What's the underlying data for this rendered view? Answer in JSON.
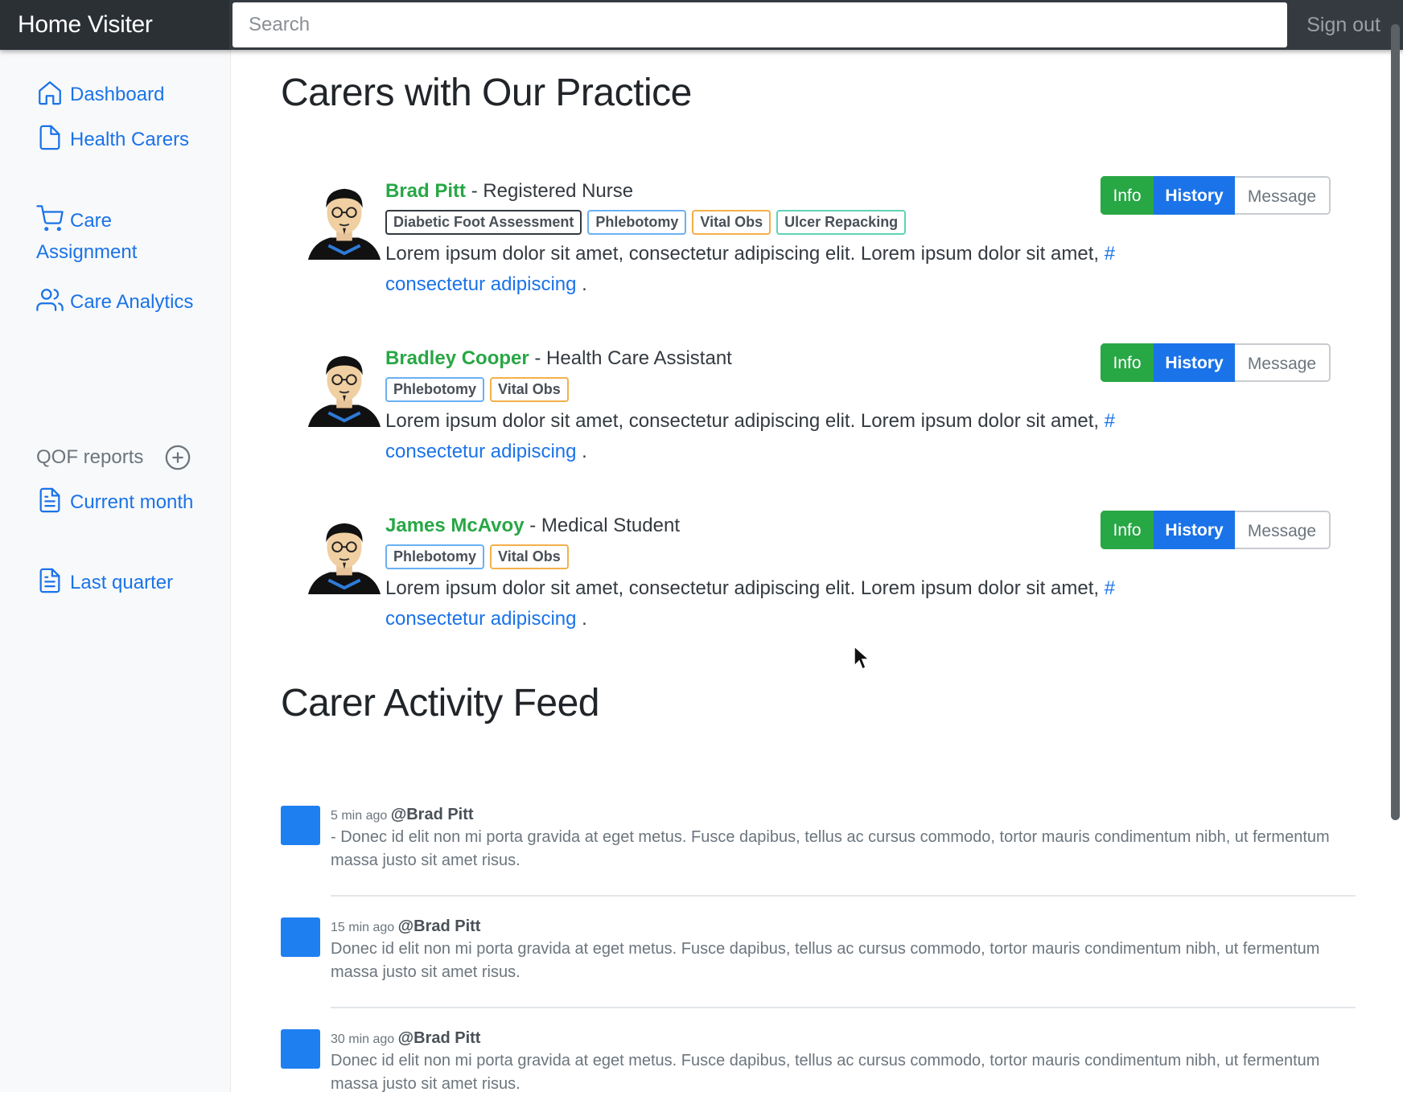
{
  "navbar": {
    "brand": "Home Visiter",
    "search_placeholder": "Search",
    "signout": "Sign out"
  },
  "sidebar": {
    "items": [
      {
        "label": "Dashboard",
        "icon": "home-icon"
      },
      {
        "label": "Health Carers",
        "icon": "file-icon"
      },
      {
        "label": "Care Assignment",
        "icon": "shopping-cart-icon"
      },
      {
        "label": "Care Analytics",
        "icon": "users-icon"
      }
    ],
    "reports_heading": "QOF reports",
    "reports": [
      {
        "label": "Current month",
        "icon": "file-text-icon"
      },
      {
        "label": "Last quarter",
        "icon": "file-text-icon"
      }
    ]
  },
  "main": {
    "carers_title": "Carers with Our Practice",
    "carers": [
      {
        "name": "Brad Pitt",
        "role": "- Registered Nurse",
        "tags": [
          {
            "label": "Diabetic Foot Assessment",
            "color": "dark"
          },
          {
            "label": "Phlebotomy",
            "color": "blue"
          },
          {
            "label": "Vital Obs",
            "color": "orange"
          },
          {
            "label": "Ulcer Repacking",
            "color": "teal"
          }
        ],
        "description": "Lorem ipsum dolor sit amet, consectetur adipiscing elit. Lorem ipsum dolor sit amet,",
        "link": "# consectetur adipiscing",
        "after_link": " ."
      },
      {
        "name": "Bradley Cooper",
        "role": "- Health Care Assistant",
        "tags": [
          {
            "label": "Phlebotomy",
            "color": "blue"
          },
          {
            "label": "Vital Obs",
            "color": "orange"
          }
        ],
        "description": "Lorem ipsum dolor sit amet, consectetur adipiscing elit. Lorem ipsum dolor sit amet,",
        "link": "# consectetur adipiscing",
        "after_link": " ."
      },
      {
        "name": "James McAvoy",
        "role": "- Medical Student",
        "tags": [
          {
            "label": "Phlebotomy",
            "color": "blue"
          },
          {
            "label": "Vital Obs",
            "color": "orange"
          }
        ],
        "description": "Lorem ipsum dolor sit amet, consectetur adipiscing elit. Lorem ipsum dolor sit amet,",
        "link": "# consectetur adipiscing",
        "after_link": " ."
      }
    ],
    "buttons": {
      "info": "Info",
      "history": "History",
      "message": "Message"
    },
    "feed_title": "Carer Activity Feed",
    "feed": [
      {
        "time": "5 min ago",
        "user": "@Brad Pitt",
        "text": "- Donec id elit non mi porta gravida at eget metus. Fusce dapibus, tellus ac cursus commodo, tortor mauris condimentum nibh, ut fermentum massa justo sit amet risus."
      },
      {
        "time": "15 min ago",
        "user": "@Brad Pitt",
        "text": "Donec id elit non mi porta gravida at eget metus. Fusce dapibus, tellus ac cursus commodo, tortor mauris condimentum nibh, ut fermentum massa justo sit amet risus."
      },
      {
        "time": "30 min ago",
        "user": "@Brad Pitt",
        "text": "Donec id elit non mi porta gravida at eget metus. Fusce dapibus, tellus ac cursus commodo, tortor mauris condimentum nibh, ut fermentum massa justo sit amet risus."
      }
    ]
  },
  "colors": {
    "navbar": "#343a40",
    "link_blue": "#1a73e8",
    "success_green": "#28a745",
    "sidebar_bg": "#f8f9fa"
  }
}
